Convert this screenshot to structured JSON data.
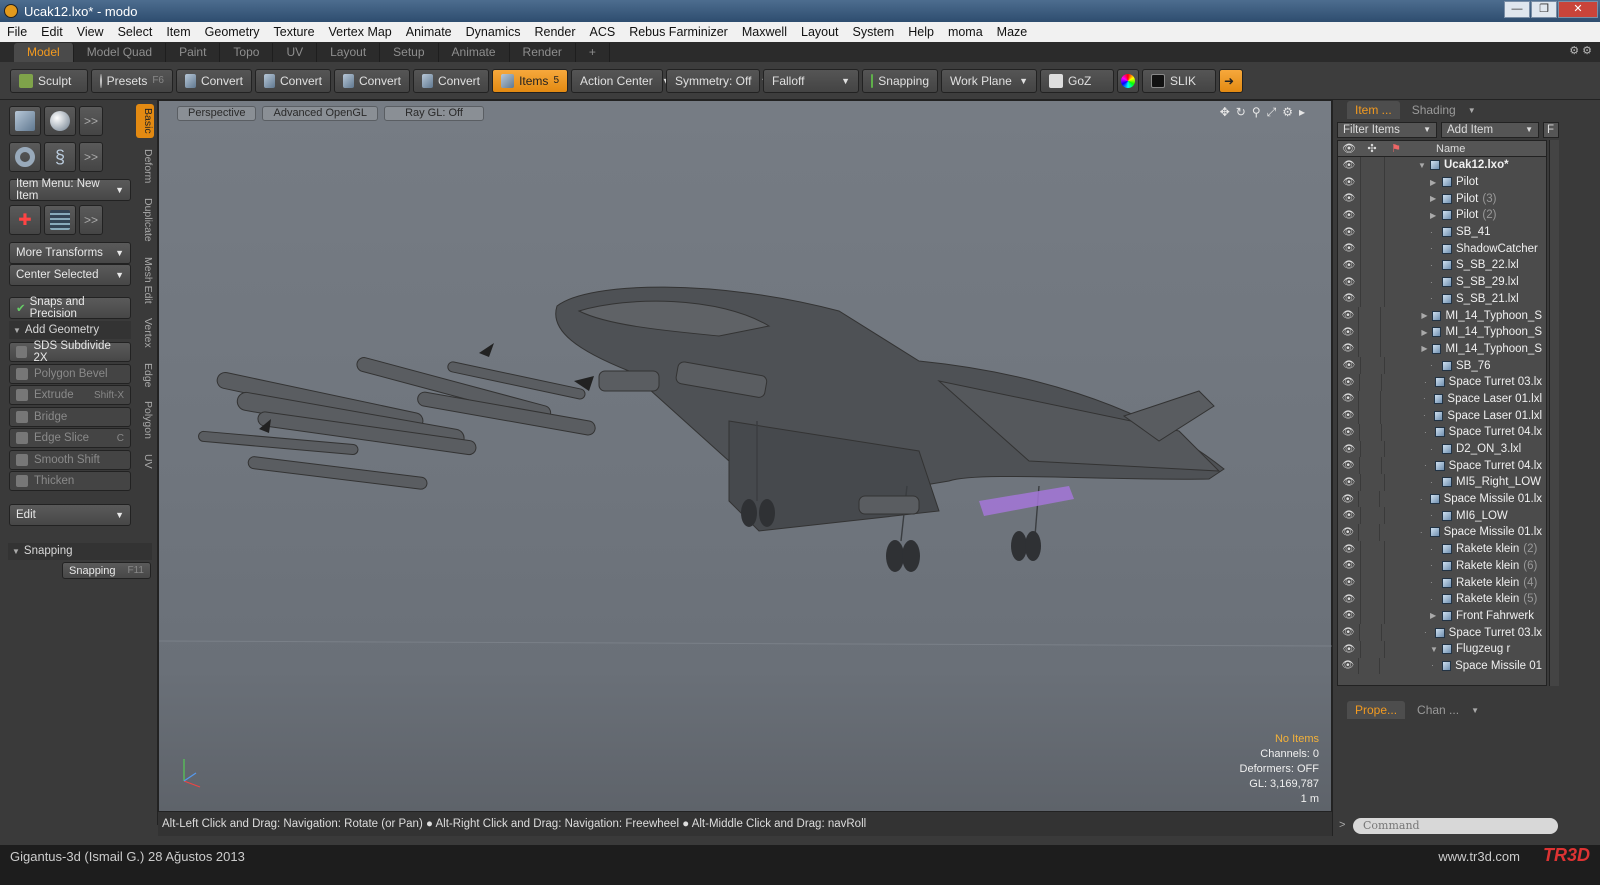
{
  "window": {
    "title": "Ucak12.lxo* - modo"
  },
  "menu": [
    "File",
    "Edit",
    "View",
    "Select",
    "Item",
    "Geometry",
    "Texture",
    "Vertex Map",
    "Animate",
    "Dynamics",
    "Render",
    "ACS",
    "Rebus Farminizer",
    "Maxwell",
    "Layout",
    "System",
    "Help",
    "moma",
    "Maze"
  ],
  "layout_tabs": [
    "Model",
    "Model Quad",
    "Paint",
    "Topo",
    "UV",
    "Layout",
    "Setup",
    "Animate",
    "Render",
    "+"
  ],
  "toolbar": {
    "sculpt": "Sculpt",
    "presets": "Presets",
    "presets_key": "F6",
    "convert1": "Convert",
    "convert2": "Convert",
    "convert3": "Convert",
    "convert4": "Convert",
    "items": "Items",
    "items_key": "5",
    "action_center": "Action Center",
    "symmetry": "Symmetry: Off",
    "falloff": "Falloff",
    "snapping": "Snapping",
    "work_plane": "Work Plane",
    "goz": "GoZ",
    "slik": "SLIK"
  },
  "left": {
    "item_menu": "Item Menu: New Item",
    "more_transforms": "More Transforms",
    "center_selected": "Center Selected",
    "snaps_precision": "Snaps and Precision",
    "add_geometry": "Add Geometry",
    "tools": [
      {
        "label": "SDS Subdivide 2X",
        "key": ""
      },
      {
        "label": "Polygon Bevel",
        "key": ""
      },
      {
        "label": "Extrude",
        "key": "Shift-X"
      },
      {
        "label": "Bridge",
        "key": ""
      },
      {
        "label": "Edge Slice",
        "key": "C"
      },
      {
        "label": "Smooth Shift",
        "key": ""
      },
      {
        "label": "Thicken",
        "key": ""
      }
    ],
    "edit": "Edit",
    "snapping_header": "Snapping",
    "snapping_btn": "Snapping",
    "snapping_key": "F11",
    "vtabs": [
      "Basic",
      "Deform",
      "Duplicate",
      "Mesh Edit",
      "Vertex",
      "Edge",
      "Polygon",
      "UV"
    ]
  },
  "viewport": {
    "view": "Perspective",
    "shading": "Advanced OpenGL",
    "raygl": "Ray GL: Off",
    "info": {
      "no_items": "No Items",
      "channels": "Channels: 0",
      "deformers": "Deformers: OFF",
      "gl": "GL: 3,169,787",
      "scale": "1 m"
    }
  },
  "status": "Alt-Left Click and Drag: Navigation: Rotate (or Pan) ● Alt-Right Click and Drag: Navigation: Freewheel ● Alt-Middle Click and Drag: navRoll",
  "right": {
    "tab_item": "Item ...",
    "tab_shading": "Shading",
    "filter": "Filter Items",
    "add_item": "Add Item",
    "f_btn": "F",
    "col_name": "Name",
    "tab_props": "Prope...",
    "tab_chan": "Chan ...",
    "command_placeholder": "Command"
  },
  "items": [
    {
      "name": "Ucak12.lxo*",
      "count": "",
      "indent": 0,
      "exp": "▼",
      "root": true
    },
    {
      "name": "Pilot",
      "count": "",
      "indent": 1,
      "exp": "▶"
    },
    {
      "name": "Pilot",
      "count": "(3)",
      "indent": 1,
      "exp": "▶"
    },
    {
      "name": "Pilot",
      "count": "(2)",
      "indent": 1,
      "exp": "▶"
    },
    {
      "name": "SB_41",
      "count": "",
      "indent": 1,
      "exp": "·"
    },
    {
      "name": "ShadowCatcher",
      "count": "",
      "indent": 1,
      "exp": "·"
    },
    {
      "name": "S_SB_22.lxl",
      "count": "",
      "indent": 1,
      "exp": "·"
    },
    {
      "name": "S_SB_29.lxl",
      "count": "",
      "indent": 1,
      "exp": "·"
    },
    {
      "name": "S_SB_21.lxl",
      "count": "",
      "indent": 1,
      "exp": "·"
    },
    {
      "name": "MI_14_Typhoon_S",
      "count": "",
      "indent": 1,
      "exp": "▶"
    },
    {
      "name": "MI_14_Typhoon_S",
      "count": "",
      "indent": 1,
      "exp": "▶"
    },
    {
      "name": "MI_14_Typhoon_S",
      "count": "",
      "indent": 1,
      "exp": "▶"
    },
    {
      "name": "SB_76",
      "count": "",
      "indent": 1,
      "exp": "·"
    },
    {
      "name": "Space Turret 03.lx",
      "count": "",
      "indent": 1,
      "exp": "·"
    },
    {
      "name": "Space Laser 01.lxl",
      "count": "",
      "indent": 1,
      "exp": "·"
    },
    {
      "name": "Space Laser 01.lxl",
      "count": "",
      "indent": 1,
      "exp": "·"
    },
    {
      "name": "Space Turret 04.lx",
      "count": "",
      "indent": 1,
      "exp": "·"
    },
    {
      "name": "D2_ON_3.lxl",
      "count": "",
      "indent": 1,
      "exp": "·"
    },
    {
      "name": "Space Turret 04.lx",
      "count": "",
      "indent": 1,
      "exp": "·"
    },
    {
      "name": "MI5_Right_LOW",
      "count": "",
      "indent": 1,
      "exp": "·"
    },
    {
      "name": "Space Missile 01.lx",
      "count": "",
      "indent": 1,
      "exp": "·"
    },
    {
      "name": "MI6_LOW",
      "count": "",
      "indent": 1,
      "exp": "·"
    },
    {
      "name": "Space Missile 01.lx",
      "count": "",
      "indent": 1,
      "exp": "·"
    },
    {
      "name": "Rakete klein",
      "count": "(2)",
      "indent": 1,
      "exp": "·"
    },
    {
      "name": "Rakete klein",
      "count": "(6)",
      "indent": 1,
      "exp": "·"
    },
    {
      "name": "Rakete klein",
      "count": "(4)",
      "indent": 1,
      "exp": "·"
    },
    {
      "name": "Rakete klein",
      "count": "(5)",
      "indent": 1,
      "exp": "·"
    },
    {
      "name": "Front Fahrwerk",
      "count": "",
      "indent": 1,
      "exp": "▶"
    },
    {
      "name": "Space Turret 03.lx",
      "count": "",
      "indent": 1,
      "exp": "·"
    },
    {
      "name": "Flugzeug r",
      "count": "",
      "indent": 1,
      "exp": "▼"
    },
    {
      "name": "Space Missile 01",
      "count": "",
      "indent": 2,
      "exp": "·"
    }
  ],
  "footer": {
    "left": "Gigantus-3d (Ismail G.)  28 Ağustos 2013",
    "right": "www.tr3d.com",
    "logo": "TR3D"
  },
  "colors": {
    "accent": "#f29a20",
    "viewport": "#737980"
  }
}
